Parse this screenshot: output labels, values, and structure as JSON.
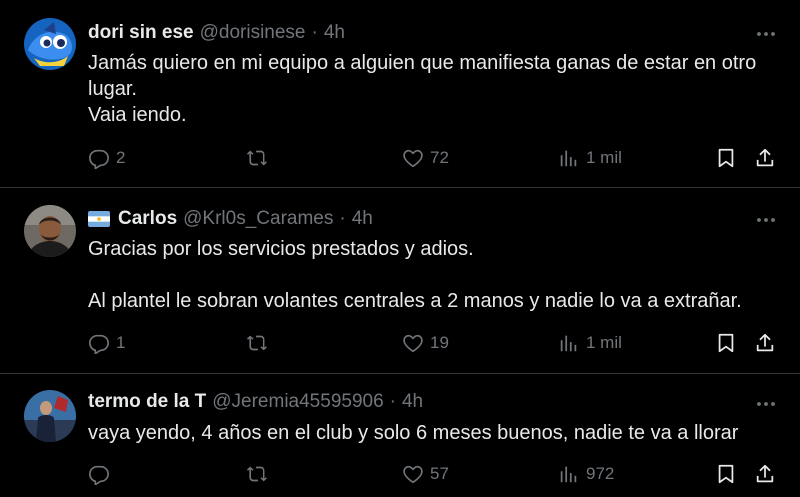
{
  "tweets": [
    {
      "name": "dori sin ese",
      "handle": "@dorisinese",
      "sep": "·",
      "time": "4h",
      "text": "Jamás quiero en mi equipo a alguien que manifiesta ganas de estar en otro lugar.\nVaia iendo.",
      "replies": "2",
      "retweets": "",
      "likes": "72",
      "views": "1 mil"
    },
    {
      "name": "Carlos",
      "handle": "@Krl0s_Carames",
      "sep": "·",
      "time": "4h",
      "text": "Gracias por los servicios prestados y adios.\n\nAl plantel le sobran volantes centrales a 2 manos y nadie lo va a extrañar.",
      "replies": "1",
      "retweets": "",
      "likes": "19",
      "views": "1 mil"
    },
    {
      "name": "termo de la T",
      "handle": "@Jeremia45595906",
      "sep": "·",
      "time": "4h",
      "text": "vaya yendo, 4 años en el club y solo 6 meses buenos, nadie te va a llorar",
      "replies": "",
      "retweets": "",
      "likes": "57",
      "views": "972"
    }
  ],
  "colors": {
    "background": "#000000",
    "text": "#e7e9ea",
    "muted": "#71767b",
    "divider": "#2f3336"
  }
}
